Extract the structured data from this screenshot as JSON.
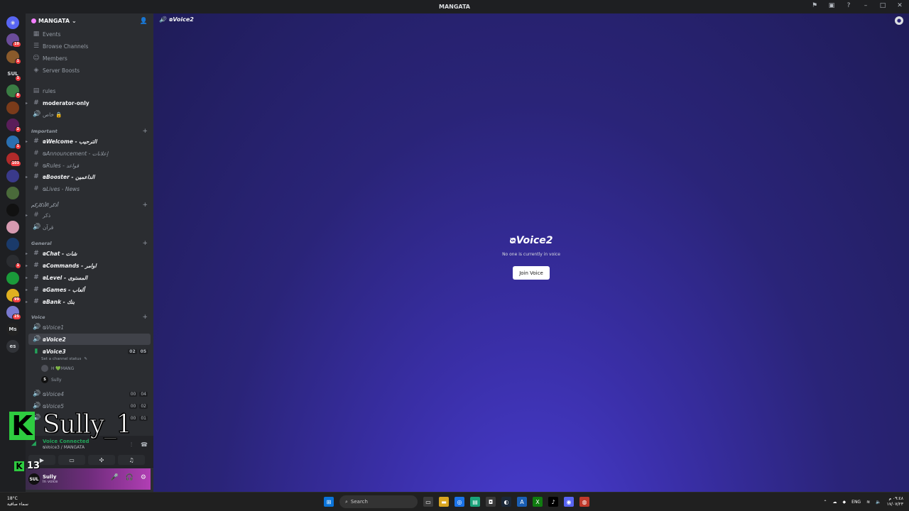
{
  "window": {
    "title": "MANGATA"
  },
  "server": {
    "name": "MANGATA"
  },
  "top_links": [
    {
      "label": "Events",
      "icon": "calendar-icon"
    },
    {
      "label": "Browse Channels",
      "icon": "browse-icon"
    },
    {
      "label": "Members",
      "icon": "members-icon"
    },
    {
      "label": "Server Boosts",
      "icon": "boost-icon"
    }
  ],
  "channels": {
    "rules": "rules",
    "moderator_only": "moderator-only",
    "private_voice": "خاص 🔒",
    "cat_important": "Important",
    "welcome": "ᴓWelcome - الترحيب",
    "announcement": "ᴓAnnouncement - إعلانات",
    "rules2": "ᴓRules - قواعد",
    "booster": "ᴓBooster - الداعمين",
    "lives": "ᴓLives - News",
    "cat_azkar": "أذكر الأذكاركم",
    "zikr": "ذكر",
    "quran": "قرآن",
    "cat_general": "General",
    "chat": "ᴓChat - شات",
    "commands": "ᴓCommands - اوامر",
    "level": "ᴓLevel - المستوى",
    "games": "ᴓGames - ألعاب",
    "bank": "ᴓBank - بنك",
    "cat_voice": "Voice",
    "voice1": "ᴓVoice1",
    "voice2": "ᴓVoice2",
    "voice3": "ᴓVoice3",
    "voice3_status": "Set a channel status",
    "voice3_counts": [
      "02",
      "05"
    ],
    "member1": "H 💚MANG",
    "member2": "Sully",
    "voice4": "ᴓVoice4",
    "voice4_counts": [
      "00",
      "04"
    ],
    "voice5": "ᴓVoice5",
    "voice5_counts": [
      "00",
      "02"
    ],
    "voice6_counts": [
      "00",
      "01"
    ]
  },
  "voice_connection": {
    "status": "Voice Connected",
    "location": "ᴓVoice3 / MANGATA"
  },
  "user": {
    "name": "Sully",
    "status": "In voice",
    "avatar_text": "SUL"
  },
  "overlay": {
    "name": "Sully_1",
    "letter": "K",
    "number": "13"
  },
  "main": {
    "header": "ᴓVoice2",
    "channel_name": "ᴓVoice2",
    "empty_text": "No one is currently in voice",
    "join_label": "Join Voice"
  },
  "servers": [
    {
      "text": "",
      "badge": "10"
    },
    {
      "text": "",
      "badge": "1"
    },
    {
      "text": "SUL",
      "badge": "1"
    },
    {
      "text": "",
      "badge": "8"
    },
    {
      "text": "",
      "badge": ""
    },
    {
      "text": "",
      "badge": "2"
    },
    {
      "text": "",
      "badge": "1"
    },
    {
      "text": "",
      "badge": "103"
    },
    {
      "text": "",
      "badge": ""
    },
    {
      "text": "",
      "badge": ""
    },
    {
      "text": "",
      "badge": ""
    },
    {
      "text": "",
      "badge": ""
    },
    {
      "text": "",
      "badge": ""
    },
    {
      "text": "",
      "badge": "1"
    },
    {
      "text": "",
      "badge": ""
    },
    {
      "text": "",
      "badge": "99"
    },
    {
      "text": "",
      "badge": "25"
    },
    {
      "text": "Ms",
      "badge": ""
    },
    {
      "text": "es",
      "badge": ""
    }
  ],
  "taskbar": {
    "weather_temp": "18°C",
    "weather_desc": "سماء صافية",
    "search": "Search",
    "lang": "ENG",
    "time": "٠٩:٤٨ م",
    "date": "١٧/٠٧/٢٣"
  },
  "colors": {
    "accent": "#23a55a",
    "main_bg": "#2a2478",
    "sidebar": "#2b2d31"
  }
}
